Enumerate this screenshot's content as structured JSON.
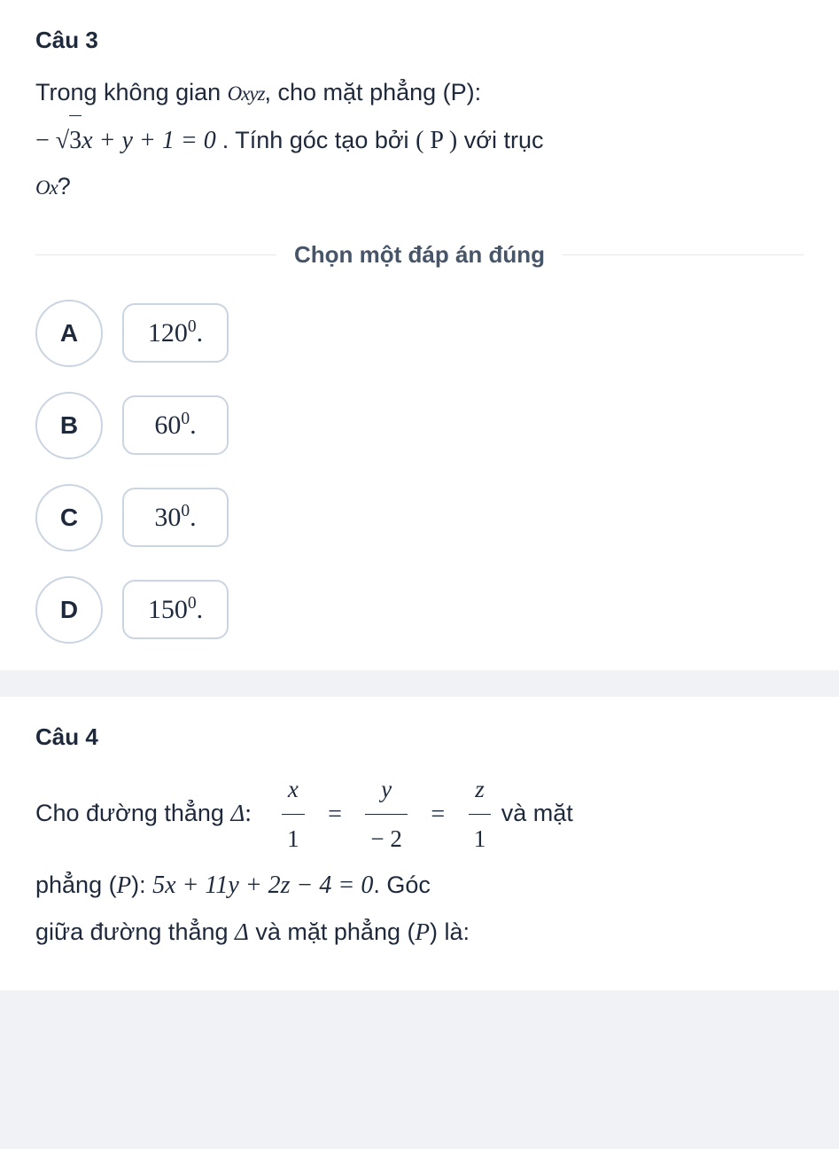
{
  "q3": {
    "title": "Câu 3",
    "text_part1": "Trong không gian ",
    "text_oxyz": "Oxyz",
    "text_part2": ", cho mặt phẳng (P):",
    "eq_minus": "− ",
    "eq_sqrt_arg": "3",
    "eq_after_sqrt": "x + y + 1 = 0",
    "text_part3": ". Tính góc tạo bởi ",
    "text_P": "( P )",
    "text_part4": " với trục",
    "text_ox": "Ox",
    "text_qmark": "?",
    "divider": "Chọn một đáp án đúng",
    "options": {
      "A": {
        "letter": "A",
        "value": "120",
        "sup": "0",
        "dot": "."
      },
      "B": {
        "letter": "B",
        "value": "60",
        "sup": "0",
        "dot": "."
      },
      "C": {
        "letter": "C",
        "value": "30",
        "sup": "0",
        "dot": "."
      },
      "D": {
        "letter": "D",
        "value": "150",
        "sup": "0",
        "dot": "."
      }
    }
  },
  "q4": {
    "title": "Câu 4",
    "text_part1": "Cho đường thẳng ",
    "delta": "Δ",
    "colon": ":",
    "frac1_num": "x",
    "frac1_den": "1",
    "eq": "=",
    "frac2_num": "y",
    "frac2_den": "−  2",
    "frac3_num": "z",
    "frac3_den": "1",
    "text_and": " và mặt",
    "text_part2a": "phẳng (",
    "text_P": "P",
    "text_part2b": "): ",
    "eq_plane": "5x   +   11y   +   2z   −   4   =   0",
    "text_part3": ". Góc",
    "text_part4a": "giữa đường thẳng ",
    "text_part4b": " và mặt phẳng (",
    "text_part4c": ") là:"
  }
}
